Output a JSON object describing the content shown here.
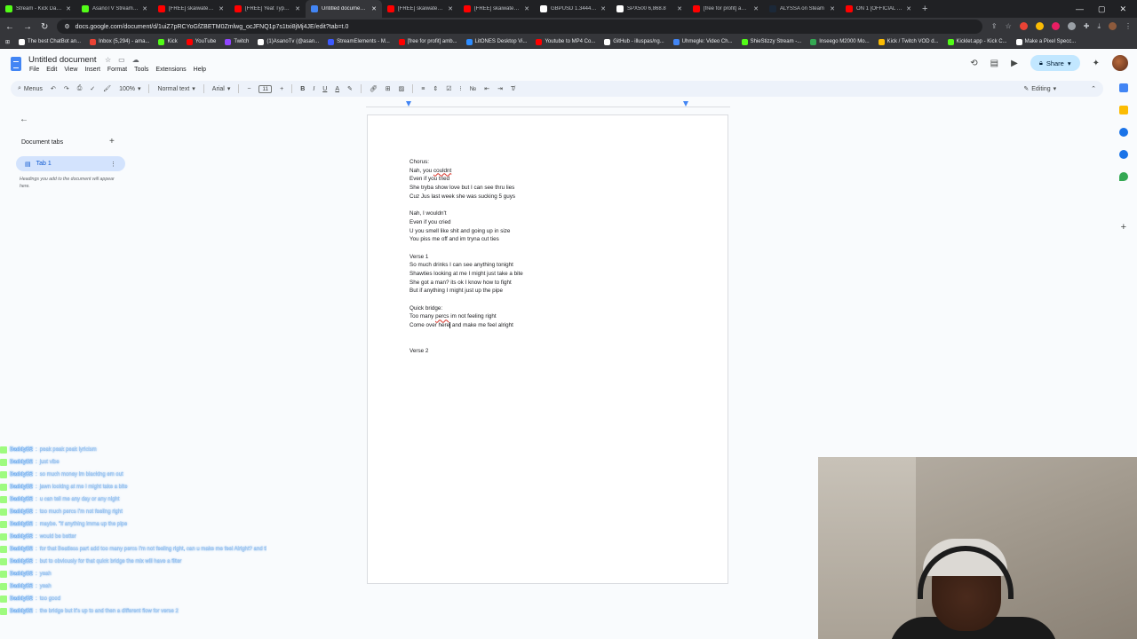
{
  "browser": {
    "tabs": [
      {
        "title": "Stream - Kick Dashboard",
        "color": "#53fc18"
      },
      {
        "title": "AsanoTV Stream - Watch L",
        "color": "#53fc18"
      },
      {
        "title": "[FREE] skaiwater x jersey",
        "color": "#ff0000"
      },
      {
        "title": "[FREE] Yeat Type Beat 2",
        "color": "#ff0000"
      },
      {
        "title": "Untitled document - G",
        "color": "#4285f4",
        "active": true
      },
      {
        "title": "[FREE] skaiwater x jersey",
        "color": "#ff0000"
      },
      {
        "title": "[FREE] skaiwater x jersey cl",
        "color": "#ff0000"
      },
      {
        "title": "GBPUSD 1.34444 +0.14",
        "color": "#ffffff"
      },
      {
        "title": "SPX500 6,868.8",
        "color": "#ffffff"
      },
      {
        "title": "[free for profit] ambient +",
        "color": "#ff0000"
      },
      {
        "title": "ALYSSA on Steam",
        "color": "#1b2838"
      },
      {
        "title": "ON 1 [OFFICIAL AUDIO] -",
        "color": "#ff0000"
      }
    ],
    "url": "docs.google.com/document/d/1uiZ7pRCYoGfZBETM0Zmlwg_ocJFNQ1p7s1txi8jMj4JE/edit?tab=t.0",
    "bookmarks": [
      {
        "label": "The best ChatBot an...",
        "color": "#ffffff"
      },
      {
        "label": "Inbox (5,294) - ama...",
        "color": "#ea4335"
      },
      {
        "label": "Kick",
        "color": "#53fc18"
      },
      {
        "label": "YouTube",
        "color": "#ff0000"
      },
      {
        "label": "Twitch",
        "color": "#9146ff"
      },
      {
        "label": "(1)AsanoTv (@asan...",
        "color": "#ffffff"
      },
      {
        "label": "StreamElements - M...",
        "color": "#3d5afe"
      },
      {
        "label": "[free for profit] amb...",
        "color": "#ff0000"
      },
      {
        "label": "LitONES Desktop Vi...",
        "color": "#2d8cff"
      },
      {
        "label": "Youtube to MP4 Co...",
        "color": "#ff0000"
      },
      {
        "label": "GitHub - illuspas/ng...",
        "color": "#ffffff"
      },
      {
        "label": "Uhmegle: Video Ch...",
        "color": "#4285f4"
      },
      {
        "label": "ShieStizzy Stream -...",
        "color": "#53fc18"
      },
      {
        "label": "Inseego M2000 Mo...",
        "color": "#34a853"
      },
      {
        "label": "Kick / Twitch VOD d...",
        "color": "#fbbc04"
      },
      {
        "label": "Kicklet.app - Kick C...",
        "color": "#53fc18"
      },
      {
        "label": "Make a Pixel Specc...",
        "color": "#ffffff"
      }
    ]
  },
  "docs": {
    "title": "Untitled document",
    "menu": [
      "File",
      "Edit",
      "View",
      "Insert",
      "Format",
      "Tools",
      "Extensions",
      "Help"
    ],
    "share_label": "Share",
    "toolbar": {
      "menus_label": "Menus",
      "zoom": "100%",
      "style": "Normal text",
      "font": "Arial",
      "font_size": "11",
      "mode": "Editing"
    },
    "sidebar": {
      "heading": "Document tabs",
      "tab_label": "Tab 1",
      "hint": "Headings you add to the document will appear here."
    },
    "body_lines": [
      "Chorus:",
      "Nah, you couldnt",
      "Even if you tried",
      "She tryba show love but I can see thru lies",
      "Cuz Jus last week she was sucking 5 guys",
      "",
      "Nah, I wouldn't",
      "Even if you cried",
      "U you smell like shit and going up in size",
      "You piss me off and im tryna cut ties",
      "",
      "Verse 1",
      "So much drinks I can see anything tonight",
      "Shawties looking at me I might just take a bite",
      "She got a man? its ok I know how to fight",
      "But if anything I might just up the pipe",
      "",
      "Quick bridge:",
      "Too many percs im not feeling right",
      "Come over here and make me feel alright",
      "",
      "",
      "Verse 2"
    ]
  },
  "chat": {
    "username": "DaddyB2",
    "messages": [
      "peak peak peak lyricism",
      "just vibe",
      "so much money im blacking em out",
      "jawn looking at me I might take a bite",
      "u can tell me any day or any night",
      "too much percs I'm not feeling right",
      "maybe. \"if anything imma up the pipe",
      "would be better",
      "for that Beatless part add too many percs I'm not feeling right, can u make me feel Alright? and then verse 2",
      "but to obviously for that quick bridge the mix will have a filter",
      "yeah",
      "yeah",
      "too good",
      "the bridge but it's up to and then a different flow for verse 2"
    ]
  }
}
